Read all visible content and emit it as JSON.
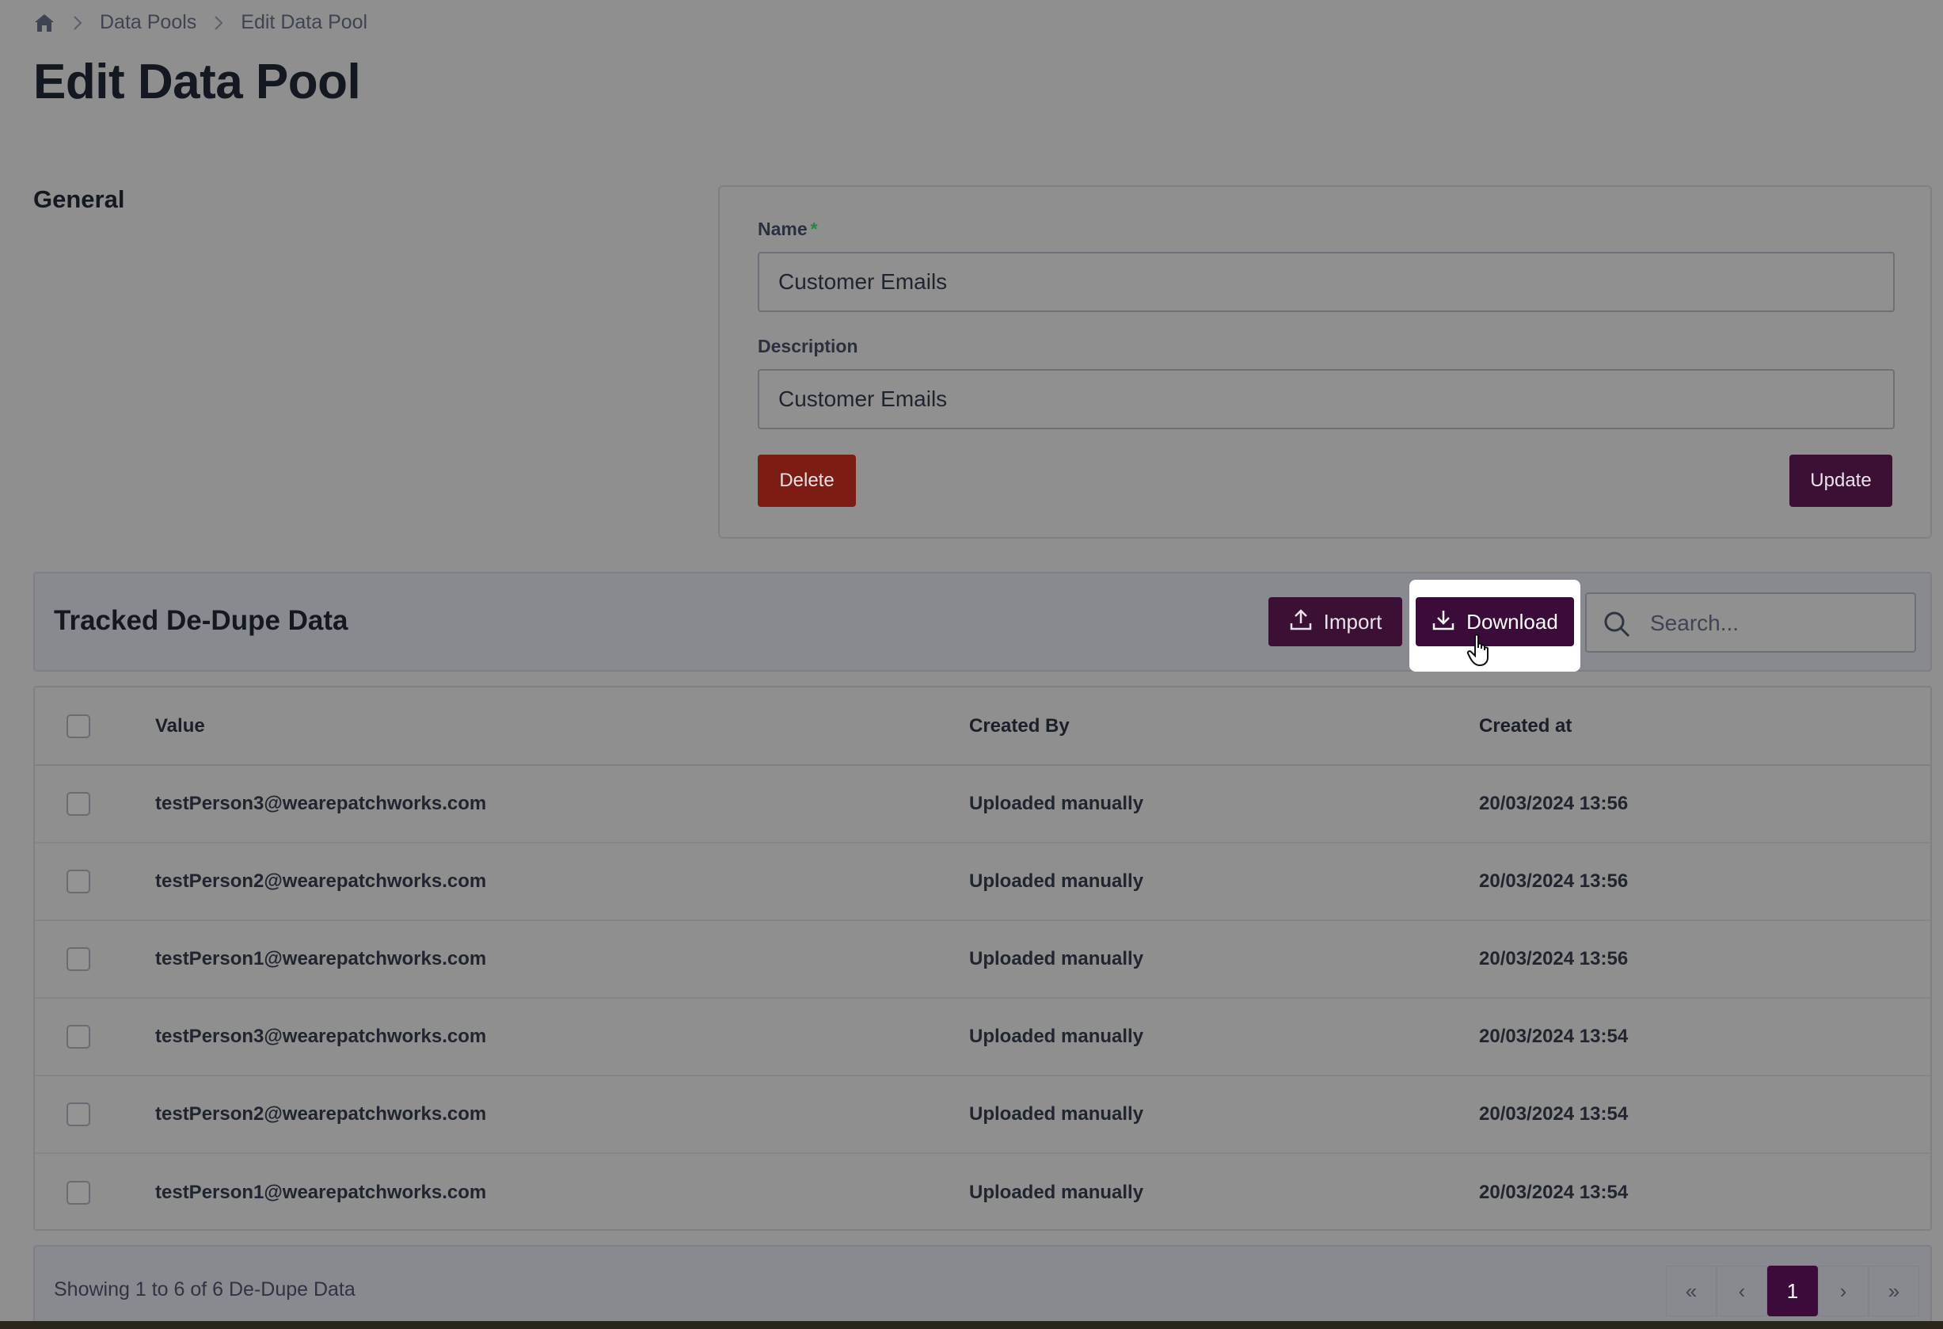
{
  "breadcrumb": {
    "home_icon": "home-icon",
    "items": [
      "Data Pools",
      "Edit Data Pool"
    ]
  },
  "page": {
    "title": "Edit Data Pool"
  },
  "general": {
    "section_title": "General",
    "name_label": "Name",
    "required_marker": "*",
    "name_value": "Customer Emails",
    "description_label": "Description",
    "description_value": "Customer Emails",
    "delete_label": "Delete",
    "update_label": "Update"
  },
  "tracked": {
    "title": "Tracked De-Dupe Data",
    "import_label": "Import",
    "download_label": "Download",
    "search_placeholder": "Search..."
  },
  "table": {
    "columns": [
      "Value",
      "Created By",
      "Created at"
    ],
    "rows": [
      {
        "value": "testPerson3@wearepatchworks.com",
        "created_by": "Uploaded manually",
        "created_at": "20/03/2024 13:56"
      },
      {
        "value": "testPerson2@wearepatchworks.com",
        "created_by": "Uploaded manually",
        "created_at": "20/03/2024 13:56"
      },
      {
        "value": "testPerson1@wearepatchworks.com",
        "created_by": "Uploaded manually",
        "created_at": "20/03/2024 13:56"
      },
      {
        "value": "testPerson3@wearepatchworks.com",
        "created_by": "Uploaded manually",
        "created_at": "20/03/2024 13:54"
      },
      {
        "value": "testPerson2@wearepatchworks.com",
        "created_by": "Uploaded manually",
        "created_at": "20/03/2024 13:54"
      },
      {
        "value": "testPerson1@wearepatchworks.com",
        "created_by": "Uploaded manually",
        "created_at": "20/03/2024 13:54"
      }
    ]
  },
  "footer": {
    "showing": "Showing 1 to 6 of 6 De-Dupe Data",
    "pagination": {
      "first": "«",
      "prev": "‹",
      "current": "1",
      "next": "›",
      "last": "»"
    }
  },
  "colors": {
    "brand": "#3b0c3a",
    "danger": "#7d1c12",
    "overlay_background": "#8f8f8f"
  }
}
